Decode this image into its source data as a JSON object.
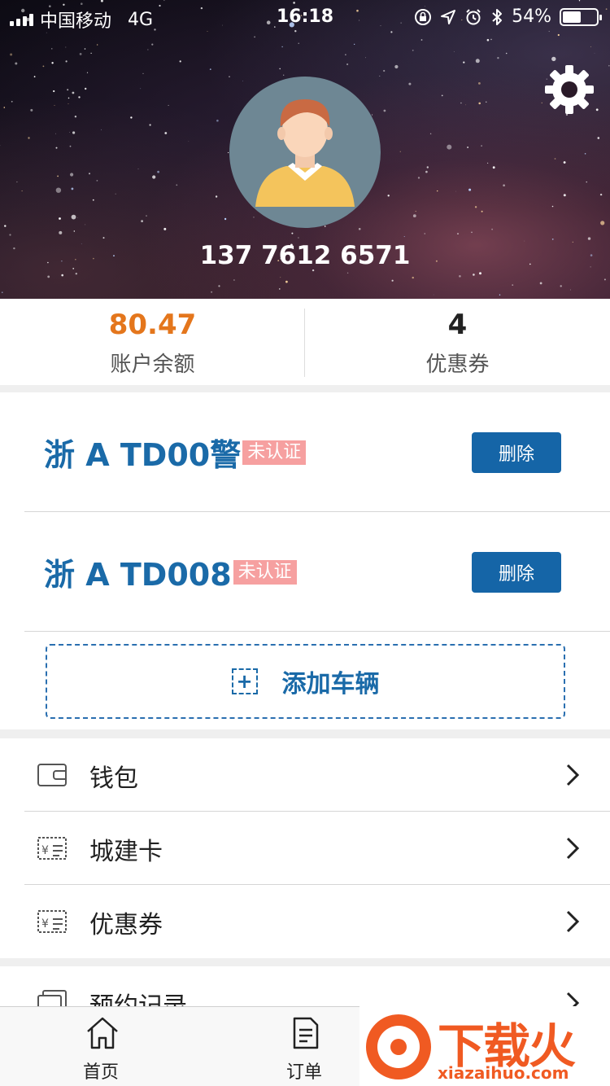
{
  "status_bar": {
    "carrier": "中国移动",
    "network": "4G",
    "time": "16:18",
    "battery": "54%"
  },
  "profile": {
    "phone": "137 7612 6571",
    "settings_icon": "gear-icon",
    "avatar_icon": "avatar-person-icon"
  },
  "stats": {
    "balance_value": "80.47",
    "balance_label": "账户余额",
    "coupon_value": "4",
    "coupon_label": "优惠券",
    "balance_color": "#e4761c"
  },
  "vehicles": [
    {
      "plate": "浙 A TD00警",
      "status": "未认证",
      "delete_label": "删除"
    },
    {
      "plate": "浙 A TD008",
      "status": "未认证",
      "delete_label": "删除"
    }
  ],
  "add_vehicle": {
    "label": "添加车辆",
    "icon": "+"
  },
  "menu": [
    {
      "label": "钱包",
      "icon": "wallet-icon"
    },
    {
      "label": "城建卡",
      "icon": "card-icon"
    },
    {
      "label": "优惠券",
      "icon": "coupon-icon"
    },
    {
      "label": "预约记录",
      "icon": "record-icon"
    }
  ],
  "tabbar": {
    "home_label": "首页",
    "orders_label": "订单"
  },
  "watermark": {
    "text": "下载火",
    "url": "xiazaihuo.com"
  },
  "colors": {
    "primary": "#1565a7",
    "plate_text": "#1a6aa8",
    "tag_bg": "#f6a0a0",
    "accent_orange": "#e4761c"
  }
}
